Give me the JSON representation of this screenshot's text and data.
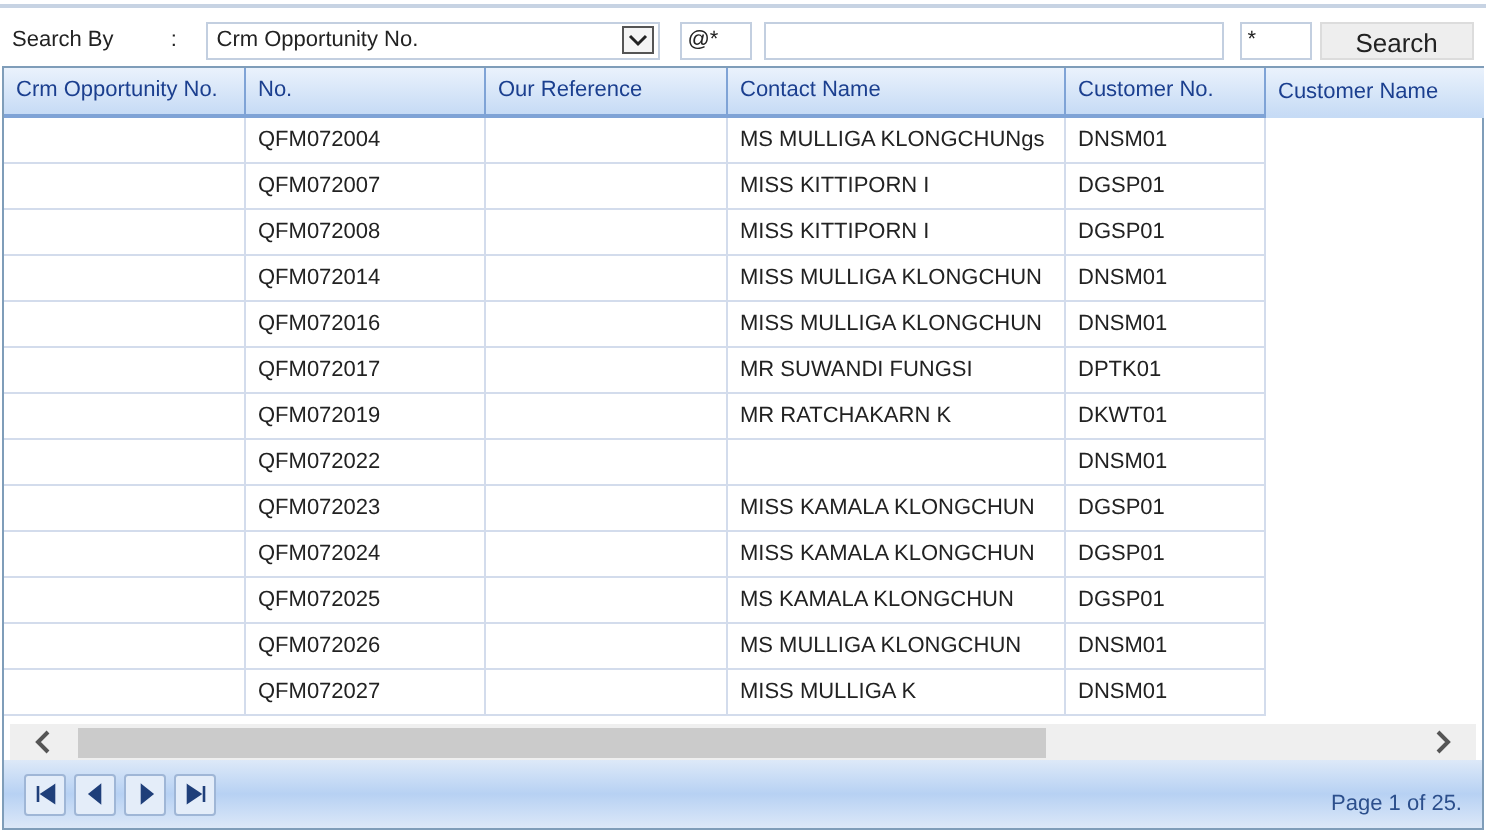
{
  "search": {
    "label": "Search By",
    "colon": ":",
    "field": "Crm Opportunity No.",
    "operator": "@*",
    "value_suffix": "*",
    "button": "Search"
  },
  "table": {
    "columns": [
      "Crm Opportunity No.",
      "No.",
      "Our Reference",
      "Contact Name",
      "Customer No.",
      "Customer Name"
    ],
    "rows": [
      {
        "no": "QFM072004",
        "contact_name": "MS MULLIGA KLONGCHUNgs",
        "customer_no": "DNSM01"
      },
      {
        "no": "QFM072007",
        "contact_name": "MISS KITTIPORN I",
        "customer_no": "DGSP01"
      },
      {
        "no": "QFM072008",
        "contact_name": "MISS KITTIPORN I",
        "customer_no": "DGSP01"
      },
      {
        "no": "QFM072014",
        "contact_name": "MISS MULLIGA KLONGCHUN",
        "customer_no": "DNSM01"
      },
      {
        "no": "QFM072016",
        "contact_name": "MISS MULLIGA KLONGCHUN",
        "customer_no": "DNSM01"
      },
      {
        "no": "QFM072017",
        "contact_name": "MR SUWANDI FUNGSI",
        "customer_no": "DPTK01"
      },
      {
        "no": "QFM072019",
        "contact_name": "MR RATCHAKARN K",
        "customer_no": "DKWT01"
      },
      {
        "no": "QFM072022",
        "customer_no": "DNSM01"
      },
      {
        "no": "QFM072023",
        "contact_name": "MISS KAMALA KLONGCHUN",
        "customer_no": "DGSP01"
      },
      {
        "no": "QFM072024",
        "contact_name": "MISS KAMALA KLONGCHUN",
        "customer_no": "DGSP01"
      },
      {
        "no": "QFM072025",
        "contact_name": "MS KAMALA KLONGCHUN",
        "customer_no": "DGSP01"
      },
      {
        "no": "QFM072026",
        "contact_name": "MS MULLIGA KLONGCHUN",
        "customer_no": "DNSM01"
      },
      {
        "no": "QFM072027",
        "contact_name": "MISS MULLIGA K",
        "customer_no": "DNSM01"
      }
    ]
  },
  "pager": {
    "status": "Page 1 of 25."
  }
}
